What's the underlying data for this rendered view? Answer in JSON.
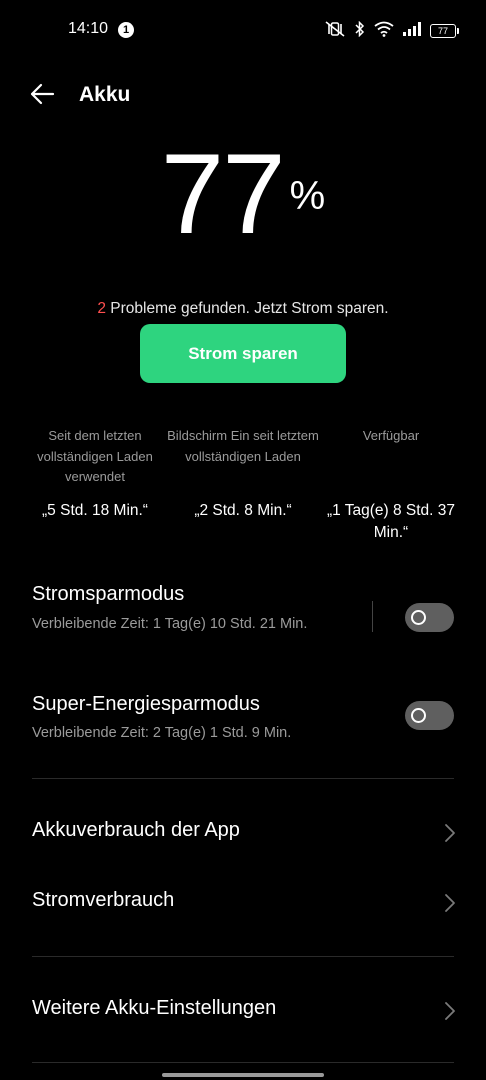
{
  "status_bar": {
    "time": "14:10",
    "notification_count": "1",
    "battery_level": "77"
  },
  "header": {
    "title": "Akku"
  },
  "battery": {
    "percent_value": "77",
    "percent_sign": "%"
  },
  "problems": {
    "count": "2",
    "message": " Probleme gefunden. Jetzt Strom sparen."
  },
  "save_button": {
    "label": "Strom sparen"
  },
  "stats": [
    {
      "label": "Seit dem letzten vollständigen Laden verwendet",
      "value": "„5 Std. 18 Min.“"
    },
    {
      "label": "Bildschirm Ein seit letztem vollständigen Laden",
      "value": "„2 Std. 8 Min.“"
    },
    {
      "label": "Verfügbar",
      "value": "„1 Tag(e) 8 Std. 37 Min.“"
    }
  ],
  "power_saving": {
    "title": "Stromsparmodus",
    "subtitle": "Verbleibende Zeit:  1 Tag(e) 10 Std. 21 Min.",
    "enabled": false
  },
  "super_saving": {
    "title": "Super-Energiesparmodus",
    "subtitle": "Verbleibende Zeit:  2 Tag(e) 1 Std. 9 Min.",
    "enabled": false
  },
  "nav_items": [
    {
      "label": "Akkuverbrauch der App"
    },
    {
      "label": "Stromverbrauch"
    },
    {
      "label": "Weitere Akku-Einstellungen"
    }
  ],
  "icons": {
    "back": "arrow-left",
    "chevron": "chevron-right",
    "mute": "vibrate-mute",
    "bluetooth": "bluetooth",
    "wifi": "wifi",
    "signal": "cell-signal",
    "battery": "battery"
  },
  "colors": {
    "accent_green": "#2ed47f",
    "problem_red": "#ff4f4f",
    "background": "#000000"
  }
}
